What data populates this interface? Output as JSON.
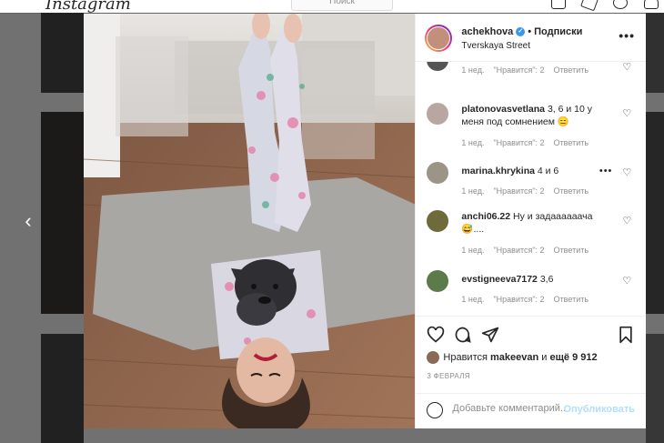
{
  "background": {
    "logo": "Instagram",
    "search_placeholder": "Поиск"
  },
  "post": {
    "username": "achekhova",
    "verified": true,
    "separator": "•",
    "follow_label": "Подписки",
    "location": "Tverskaya Street",
    "more_label": "•••"
  },
  "comments": [
    {
      "username": "",
      "text": "",
      "time": "1 нед.",
      "likes": "\"Нравится\": 2",
      "reply": "Ответить",
      "avatar_color": "#555555"
    },
    {
      "username": "platonovasvetlana",
      "text": "3, 6 и 10 у меня под сомнением 😑",
      "time": "1 нед.",
      "likes": "\"Нравится\": 2",
      "reply": "Ответить",
      "avatar_color": "#b7a7a0"
    },
    {
      "username": "marina.khrykina",
      "text": "4 и 6",
      "time": "1 нед.",
      "likes": "\"Нравится\": 2",
      "reply": "Ответить",
      "avatar_color": "#9c9486"
    },
    {
      "username": "anchi06.22",
      "text": "Ну и задаааааача 😅....",
      "time": "1 нед.",
      "likes": "\"Нравится\": 2",
      "reply": "Ответить",
      "avatar_color": "#6e6a3a"
    },
    {
      "username": "evstigneeva7172",
      "text": "3,6",
      "time": "1 нед.",
      "likes": "\"Нравится\": 2",
      "reply": "Ответить",
      "avatar_color": "#5d7a4a"
    }
  ],
  "actions": {
    "likes_prefix": "Нравится",
    "liker": "makeevan",
    "likes_connector": "и",
    "likes_count": "ещё 9 912",
    "date": "3 ФЕВРАЛЯ"
  },
  "add_comment": {
    "placeholder": "Добавьте комментарий...",
    "post_label": "Опубликовать"
  },
  "nav": {
    "prev_arrow": "‹"
  }
}
